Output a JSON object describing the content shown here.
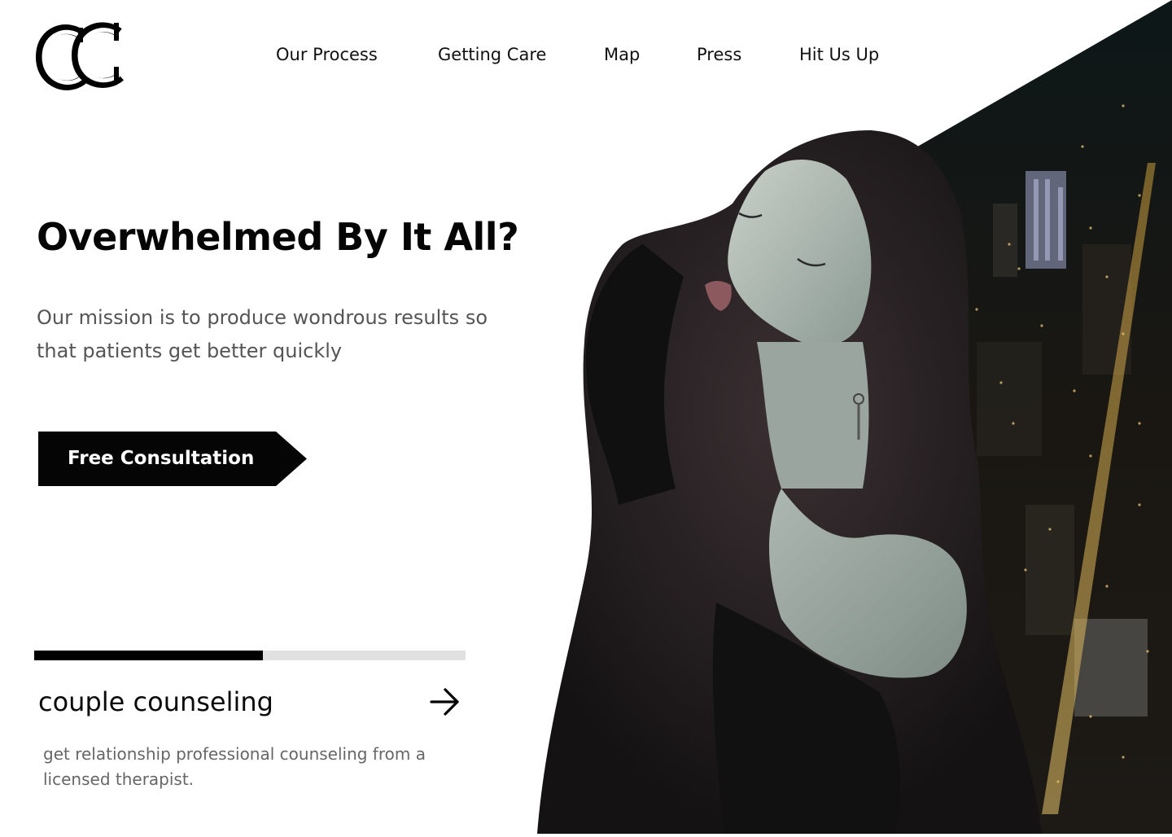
{
  "brand": {
    "logo_icon": "double-c-monogram-logo"
  },
  "nav": {
    "items": [
      {
        "label": "Our Process"
      },
      {
        "label": "Getting Care"
      },
      {
        "label": "Map"
      },
      {
        "label": "Press"
      },
      {
        "label": "Hit Us Up"
      }
    ]
  },
  "hero": {
    "title": "Overwhelmed By It All?",
    "subtitle": "Our mission is to produce wondrous results so that patients get better quickly",
    "cta_label": "Free Consultation",
    "image_icon": "woman-over-night-city-photo"
  },
  "service_slider": {
    "progress": 0.53,
    "title": "couple counseling",
    "description": "get relationship professional counseling from a licensed therapist.",
    "next_icon": "arrow-right-icon"
  },
  "colors": {
    "primary": "#050505",
    "background": "#ffffff",
    "text_muted": "#555555",
    "track": "#e1e1e1"
  }
}
